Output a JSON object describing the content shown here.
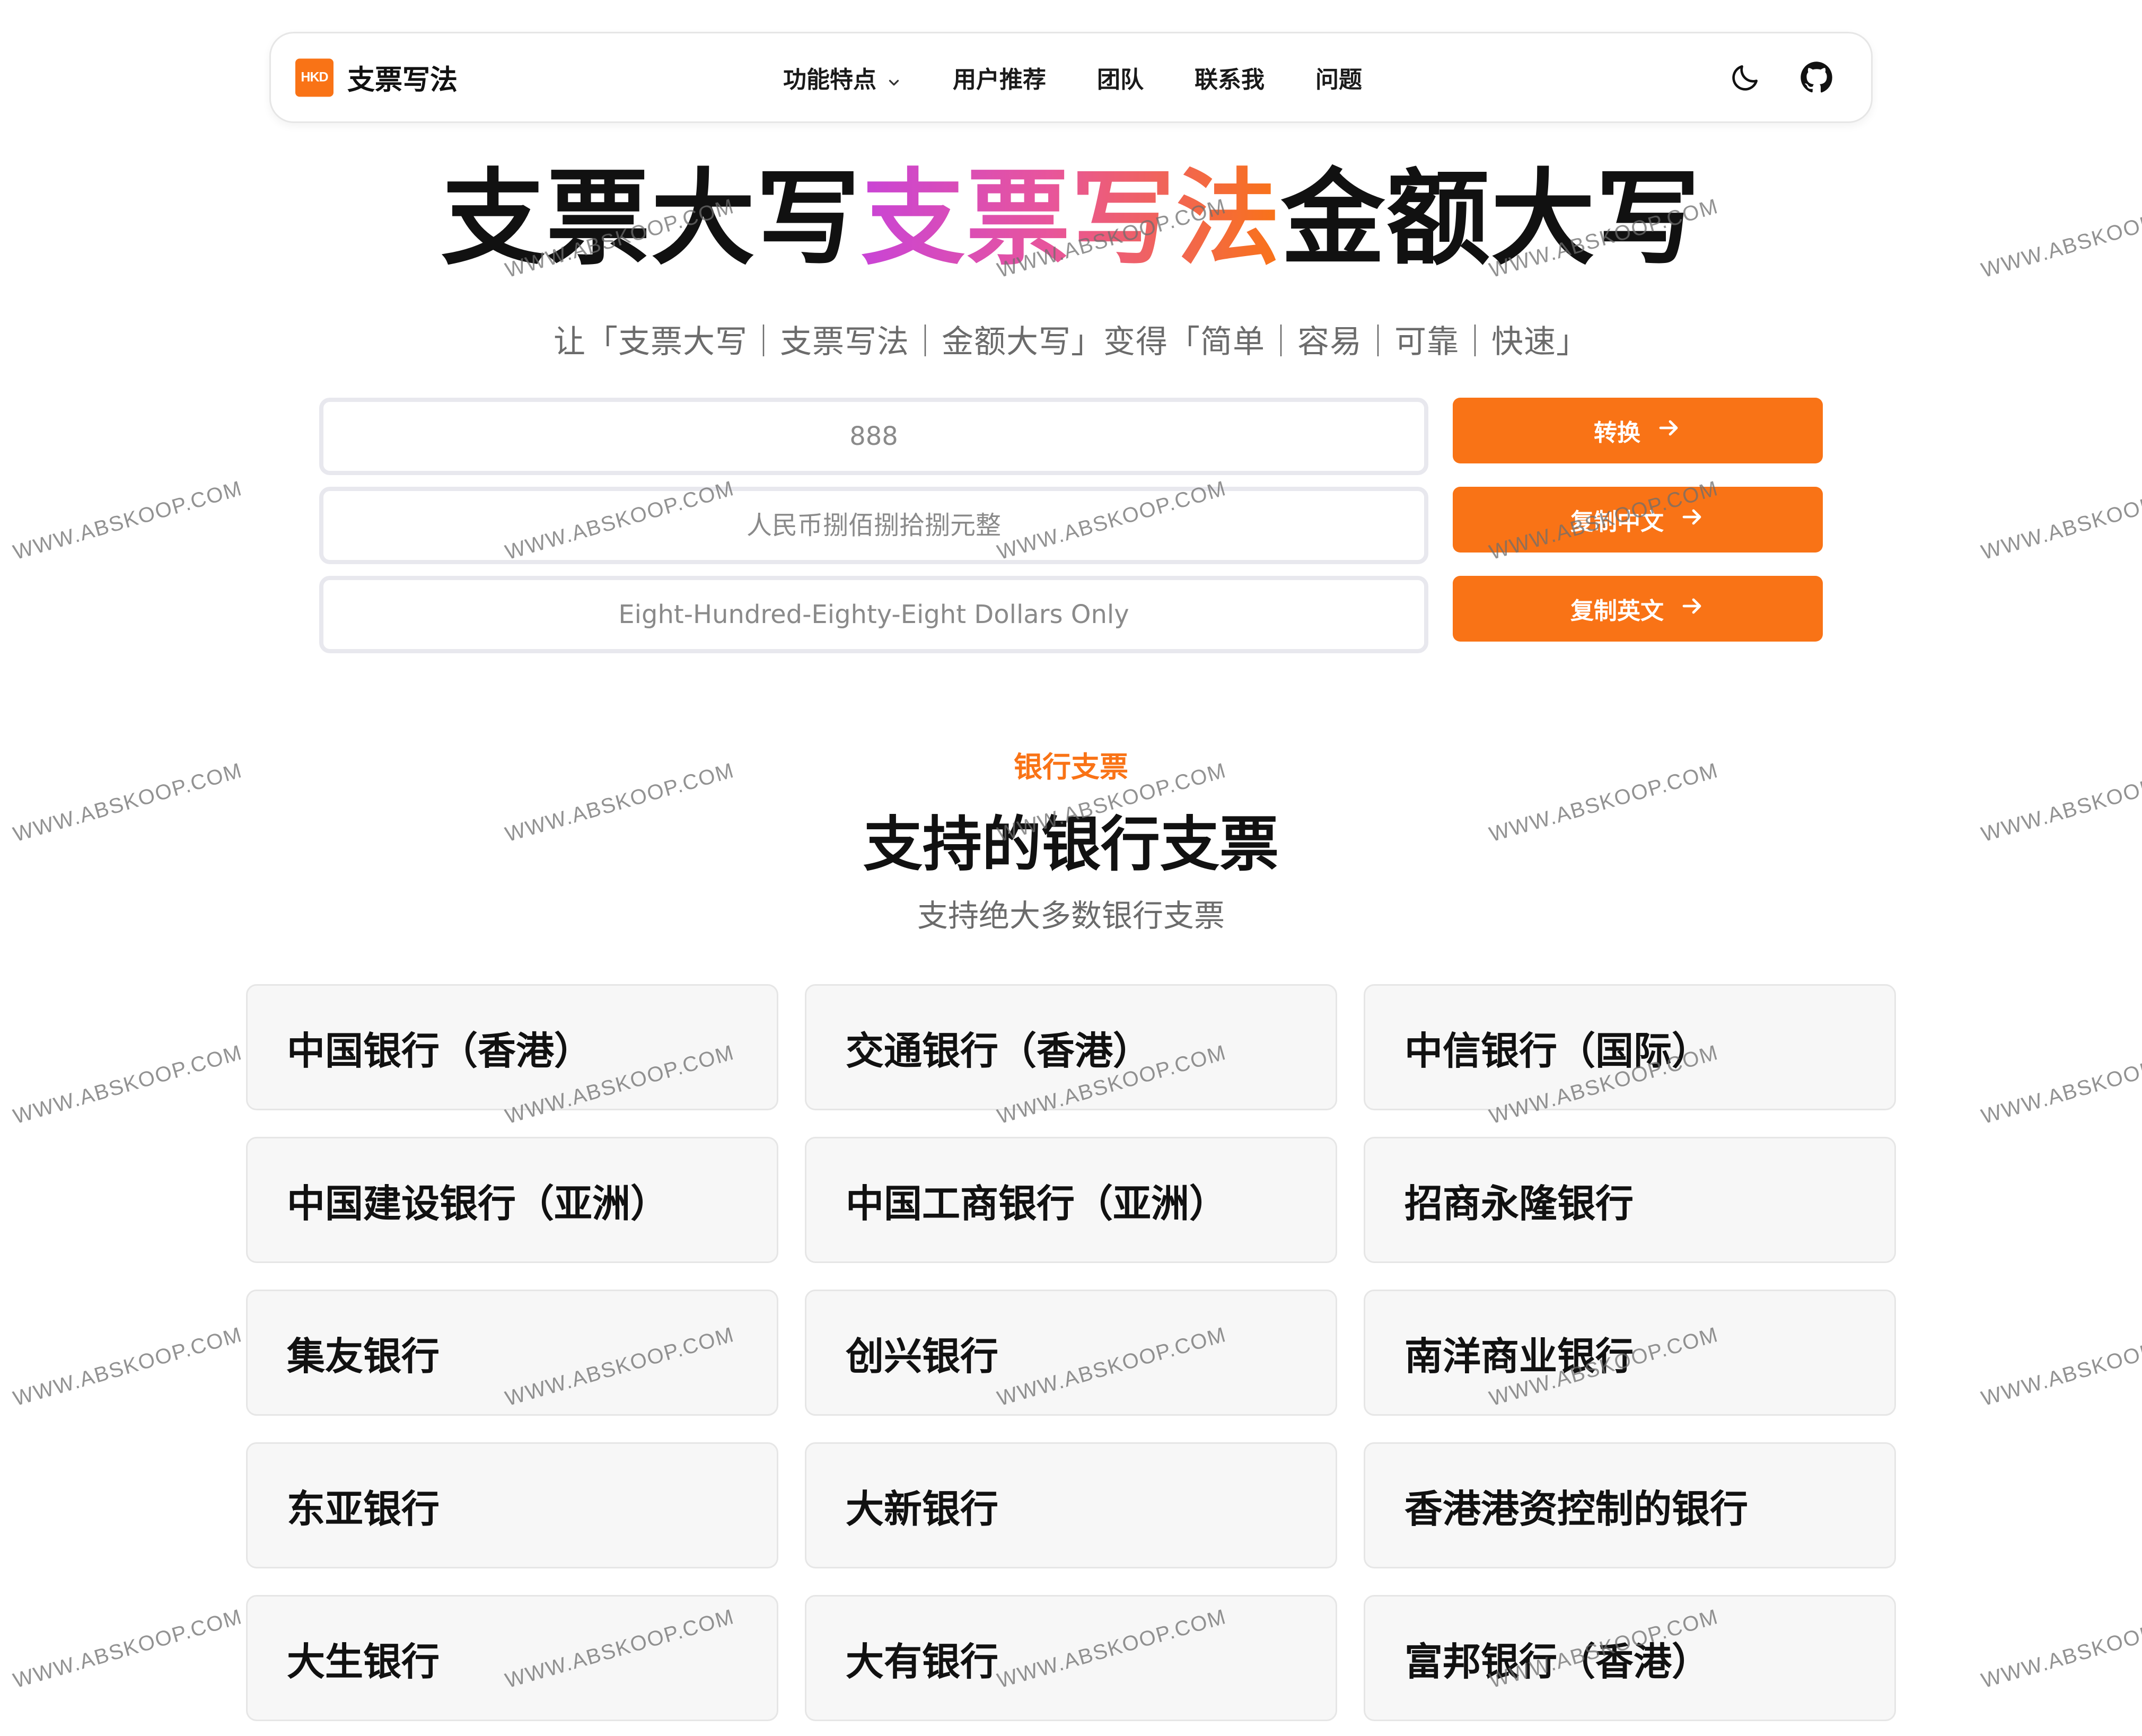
{
  "navbar": {
    "logo_badge": "HKD",
    "logo_text": "支票写法",
    "menu": [
      {
        "label": "功能特点"
      },
      {
        "label": "用户推荐"
      },
      {
        "label": "团队"
      },
      {
        "label": "联系我"
      },
      {
        "label": "问题"
      }
    ],
    "icons": [
      "moon-icon",
      "github-icon"
    ]
  },
  "hero": {
    "title_part1": "支票大写",
    "title_part2": "支票写法",
    "title_part3": "金额大写",
    "subtitle": "让「支票大写｜支票写法｜金额大写」变得「简单｜容易｜可靠｜快速」"
  },
  "converter": {
    "amount_placeholder": "888",
    "chinese_placeholder": "人民币捌佰捌拾捌元整",
    "english_placeholder": "Eight-Hundred-Eighty-Eight Dollars Only",
    "convert_label": "转换",
    "copy_chinese_label": "复制中文",
    "copy_english_label": "复制英文"
  },
  "banks_section": {
    "eyebrow": "银行支票",
    "title": "支持的银行支票",
    "subtitle": "支持绝大多数银行支票",
    "banks": [
      "中国银行（香港）",
      "交通银行（香港）",
      "中信银行（国际）",
      "中国建设银行（亚洲）",
      "中国工商银行（亚洲）",
      "招商永隆银行",
      "集友银行",
      "创兴银行",
      "南洋商业银行",
      "东亚银行",
      "大新银行",
      "香港港资控制的银行",
      "大生银行",
      "大有银行",
      "富邦银行（香港）"
    ]
  },
  "watermark": "WWW.ABSKOOP.COM",
  "colors": {
    "accent": "#f97316",
    "gradient_start": "#c944d6",
    "gradient_end": "#f97316"
  }
}
